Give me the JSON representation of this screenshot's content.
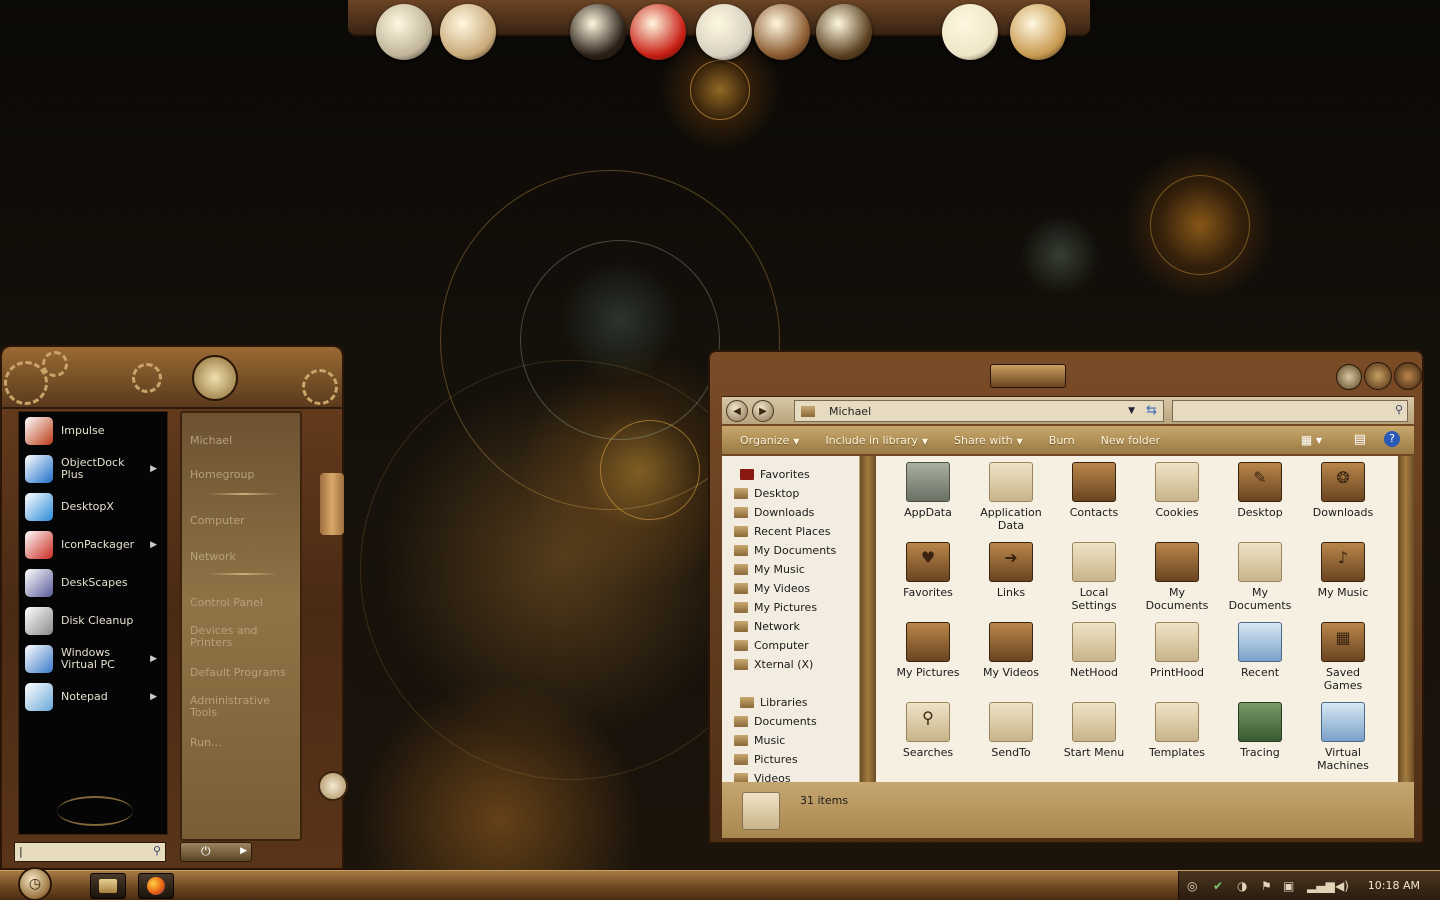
{
  "dock": {
    "icons": [
      {
        "name": "coin-icon",
        "color": "#bfb49a"
      },
      {
        "name": "gauge-icon",
        "color": "#c9aa7a"
      },
      {
        "name": "compass-icon",
        "color": "#2a2018"
      },
      {
        "name": "red-seal-icon",
        "color": "#c81e14"
      },
      {
        "name": "gramophone-icon",
        "color": "#d8d0c0"
      },
      {
        "name": "typewriter-icon",
        "color": "#8a5a30"
      },
      {
        "name": "crate-icon",
        "color": "#5a4020"
      },
      {
        "name": "clock-icon",
        "color": "#efe6c8"
      },
      {
        "name": "paper-bag-icon",
        "color": "#c89a50"
      }
    ]
  },
  "start_menu": {
    "programs": [
      {
        "label": "Impulse",
        "icon": "impulse-icon",
        "arrow": false,
        "color": "#b83a14"
      },
      {
        "label": "ObjectDock\nPlus",
        "icon": "objectdock-icon",
        "arrow": true,
        "color": "#1e6ec8"
      },
      {
        "label": "DesktopX",
        "icon": "desktopx-icon",
        "arrow": false,
        "color": "#2a8ad8"
      },
      {
        "label": "IconPackager",
        "icon": "iconpackager-icon",
        "arrow": true,
        "color": "#c8281e"
      },
      {
        "label": "DeskScapes",
        "icon": "deskscapes-icon",
        "arrow": false,
        "color": "#5a5a9a"
      },
      {
        "label": "Disk Cleanup",
        "icon": "disk-cleanup-icon",
        "arrow": false,
        "color": "#8a8a8a"
      },
      {
        "label": "Windows\nVirtual PC",
        "icon": "virtual-pc-icon",
        "arrow": true,
        "color": "#3a7ac8"
      },
      {
        "label": "Notepad",
        "icon": "notepad-icon",
        "arrow": true,
        "color": "#6aa8d8"
      }
    ],
    "places": [
      {
        "label": "Michael"
      },
      {
        "label": "Homegroup"
      },
      {
        "label": "Computer"
      },
      {
        "label": "Network"
      },
      {
        "label": "Control Panel"
      },
      {
        "label": "Devices and\nPrinters"
      },
      {
        "label": "Default Programs"
      },
      {
        "label": "Administrative\nTools"
      },
      {
        "label": "Run..."
      }
    ],
    "search_value": "|"
  },
  "explorer": {
    "address": "Michael",
    "commands": [
      "Organize",
      "Include in library",
      "Share with",
      "Burn",
      "New folder"
    ],
    "nav_favorites_header": "Favorites",
    "nav_favorites": [
      "Desktop",
      "Downloads",
      "Recent Places",
      "My Documents",
      "My Music",
      "My Videos",
      "My Pictures",
      "Network",
      "Computer",
      "Xternal (X)"
    ],
    "nav_libraries_header": "Libraries",
    "nav_libraries": [
      "Documents",
      "Music",
      "Pictures",
      "Videos"
    ],
    "items": [
      {
        "label": "AppData",
        "style": "grey",
        "glyph": ""
      },
      {
        "label": "Application\nData",
        "style": "",
        "glyph": ""
      },
      {
        "label": "Contacts",
        "style": "dark",
        "glyph": ""
      },
      {
        "label": "Cookies",
        "style": "",
        "glyph": ""
      },
      {
        "label": "Desktop",
        "style": "dark",
        "glyph": "✎"
      },
      {
        "label": "Downloads",
        "style": "dark",
        "glyph": "❂"
      },
      {
        "label": "Favorites",
        "style": "dark",
        "glyph": "♥"
      },
      {
        "label": "Links",
        "style": "dark",
        "glyph": "➜"
      },
      {
        "label": "Local\nSettings",
        "style": "",
        "glyph": ""
      },
      {
        "label": "My\nDocuments",
        "style": "dark",
        "glyph": ""
      },
      {
        "label": "My\nDocuments",
        "style": "",
        "glyph": ""
      },
      {
        "label": "My Music",
        "style": "dark",
        "glyph": "♪"
      },
      {
        "label": "My Pictures",
        "style": "dark",
        "glyph": ""
      },
      {
        "label": "My Videos",
        "style": "dark",
        "glyph": ""
      },
      {
        "label": "NetHood",
        "style": "",
        "glyph": ""
      },
      {
        "label": "PrintHood",
        "style": "",
        "glyph": ""
      },
      {
        "label": "Recent",
        "style": "blue",
        "glyph": ""
      },
      {
        "label": "Saved\nGames",
        "style": "dark",
        "glyph": "▦"
      },
      {
        "label": "Searches",
        "style": "",
        "glyph": "⚲"
      },
      {
        "label": "SendTo",
        "style": "",
        "glyph": ""
      },
      {
        "label": "Start Menu",
        "style": "",
        "glyph": ""
      },
      {
        "label": "Templates",
        "style": "",
        "glyph": ""
      },
      {
        "label": "Tracing",
        "style": "green",
        "glyph": ""
      },
      {
        "label": "Virtual\nMachines",
        "style": "blue",
        "glyph": ""
      }
    ],
    "status": "31 items"
  },
  "taskbar": {
    "clock": "10:18 AM"
  }
}
